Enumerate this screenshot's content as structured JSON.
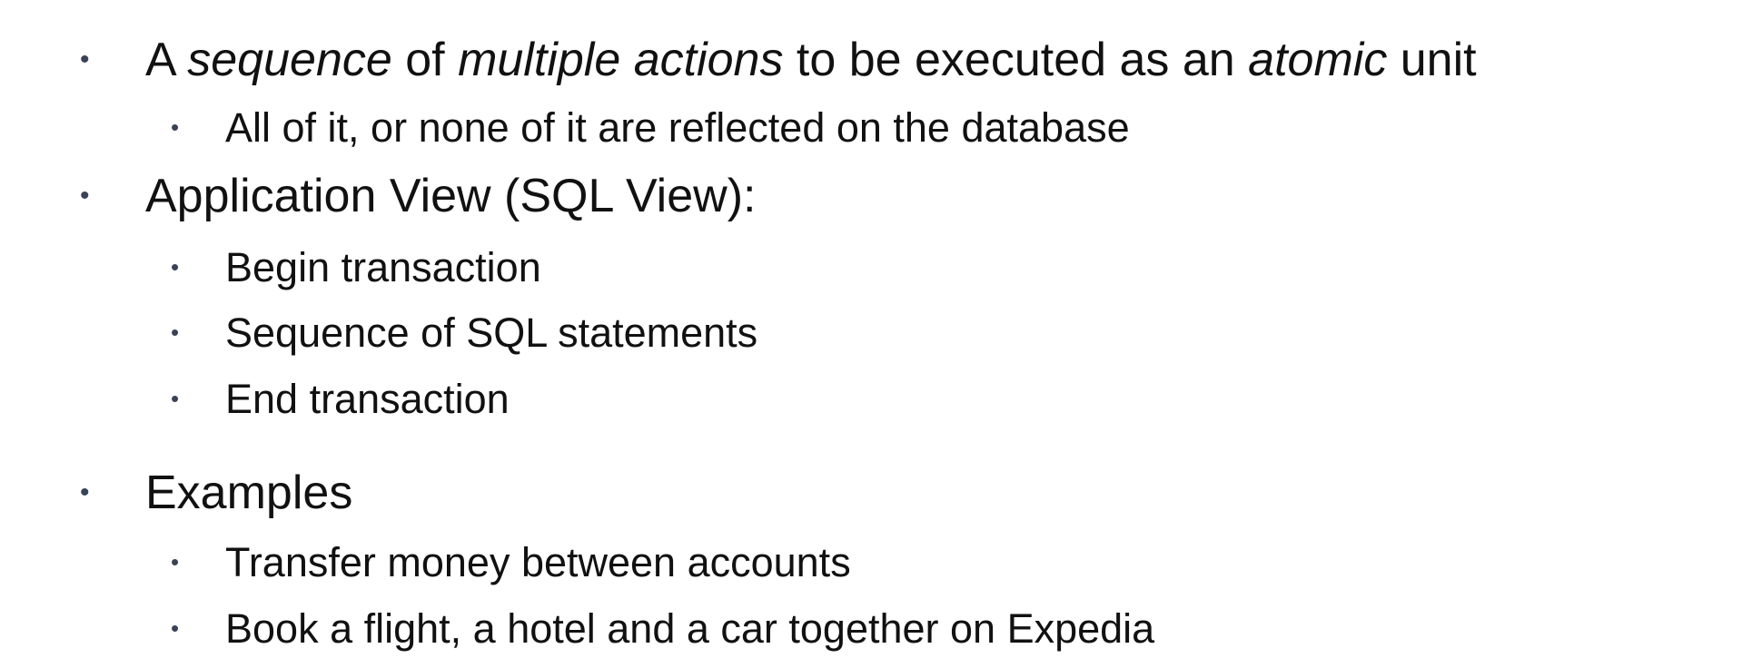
{
  "bullet_glyph": "•",
  "items": [
    {
      "level": 1,
      "runs": [
        {
          "text": "A ",
          "italic": false
        },
        {
          "text": "sequence",
          "italic": true
        },
        {
          "text": " of ",
          "italic": false
        },
        {
          "text": "multiple actions",
          "italic": true
        },
        {
          "text": " to be executed as an ",
          "italic": false
        },
        {
          "text": "atomic",
          "italic": true
        },
        {
          "text": " unit",
          "italic": false
        }
      ]
    },
    {
      "level": 2,
      "runs": [
        {
          "text": "All of it, or none of it are reflected on the database",
          "italic": false
        }
      ]
    },
    {
      "level": 1,
      "runs": [
        {
          "text": "Application View (SQL View):",
          "italic": false
        }
      ]
    },
    {
      "level": 2,
      "runs": [
        {
          "text": "Begin transaction",
          "italic": false
        }
      ]
    },
    {
      "level": 2,
      "runs": [
        {
          "text": "Sequence of SQL statements",
          "italic": false
        }
      ]
    },
    {
      "level": 2,
      "runs": [
        {
          "text": "End transaction",
          "italic": false
        }
      ]
    },
    {
      "level": 1,
      "runs": [
        {
          "text": "Examples",
          "italic": false
        }
      ]
    },
    {
      "level": 2,
      "runs": [
        {
          "text": "Transfer money between accounts",
          "italic": false
        }
      ]
    },
    {
      "level": 2,
      "runs": [
        {
          "text": "Book a flight, a hotel and a car together on Expedia",
          "italic": false
        }
      ]
    }
  ]
}
